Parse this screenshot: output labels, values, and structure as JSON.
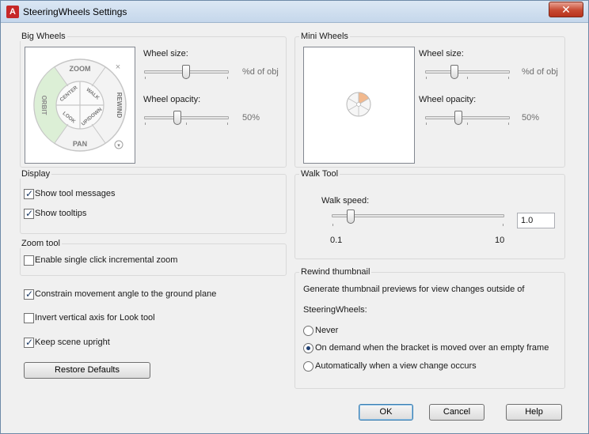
{
  "window": {
    "title": "SteeringWheels Settings",
    "app_icon": "autocad-a-icon",
    "close_symbol": "✕"
  },
  "big_wheels": {
    "title": "Big Wheels",
    "wheel_size_label": "Wheel size:",
    "wheel_size_value": "%d of obj",
    "wheel_opacity_label": "Wheel opacity:",
    "wheel_opacity_value": "50%",
    "preview": {
      "top": "ZOOM",
      "left": "ORBIT",
      "right": "REWIND",
      "bottom": "PAN",
      "inner_top_left": "CENTER",
      "inner_top_right": "WALK",
      "inner_bottom_left": "LOOK",
      "inner_bottom_right": "UP/DOWN",
      "close_symbol": "×",
      "menu_symbol": "▾"
    }
  },
  "mini_wheels": {
    "title": "Mini Wheels",
    "wheel_size_label": "Wheel size:",
    "wheel_size_value": "%d of obj",
    "wheel_opacity_label": "Wheel opacity:",
    "wheel_opacity_value": "50%"
  },
  "display": {
    "title": "Display",
    "show_tool_messages": "Show tool messages",
    "show_tooltips": "Show tooltips"
  },
  "zoom_tool": {
    "title": "Zoom tool",
    "single_click": "Enable single click incremental zoom"
  },
  "options": {
    "constrain": "Constrain movement angle to the ground plane",
    "invert": "Invert vertical axis for Look tool",
    "keep_upright": "Keep scene upright"
  },
  "restore_defaults": "Restore Defaults",
  "walk_tool": {
    "title": "Walk Tool",
    "walk_speed_label": "Walk speed:",
    "walk_speed_value": "1.0",
    "min_label": "0.1",
    "max_label": "10"
  },
  "rewind": {
    "title": "Rewind thumbnail",
    "description_1": "Generate thumbnail previews for view changes outside of",
    "description_2": "SteeringWheels:",
    "never": "Never",
    "on_demand": "On demand when the bracket is moved over an empty frame",
    "automatically": "Automatically when a view change occurs"
  },
  "buttons": {
    "ok": "OK",
    "cancel": "Cancel",
    "help": "Help"
  },
  "state": {
    "show_tool_messages": true,
    "show_tooltips": true,
    "single_click_zoom": false,
    "constrain": true,
    "invert": false,
    "keep_upright": true,
    "rewind_mode": "on_demand"
  }
}
